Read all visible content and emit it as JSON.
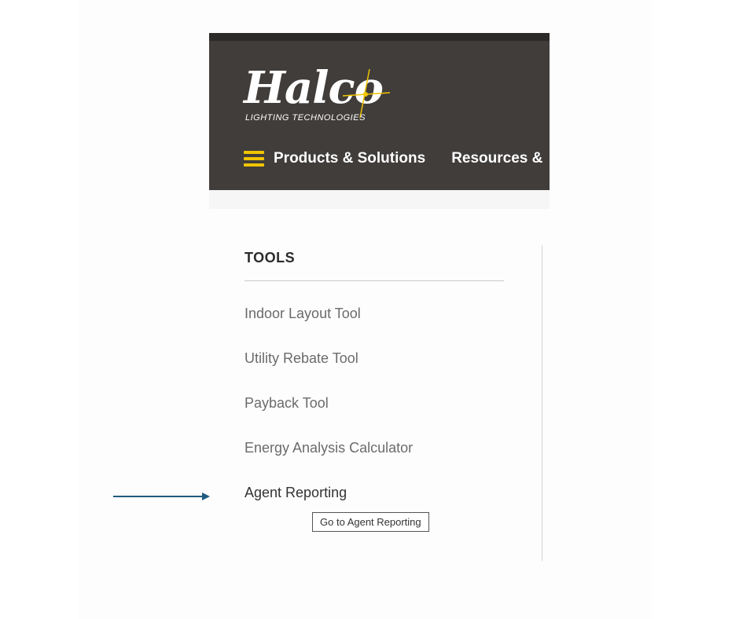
{
  "brand": {
    "name": "Halco",
    "tagline": "LIGHTING TECHNOLOGIES",
    "accent_color": "#f0c400",
    "header_color": "#403d3b"
  },
  "nav": {
    "menu_icon": "hamburger-icon",
    "items": [
      {
        "label": "Products & Solutions"
      },
      {
        "label": "Resources &"
      }
    ]
  },
  "tools": {
    "heading": "TOOLS",
    "links": [
      {
        "label": "Indoor Layout Tool"
      },
      {
        "label": "Utility Rebate Tool"
      },
      {
        "label": "Payback Tool"
      },
      {
        "label": "Energy Analysis Calculator"
      },
      {
        "label": "Agent Reporting"
      }
    ]
  },
  "tooltip": {
    "text": "Go to Agent Reporting"
  },
  "annotation": {
    "arrow_color": "#1f5a80"
  }
}
